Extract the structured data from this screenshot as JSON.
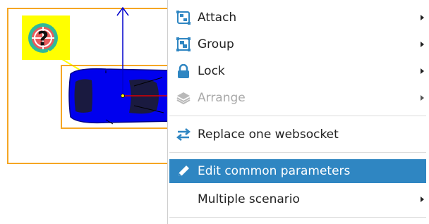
{
  "menu": {
    "items": [
      {
        "label": "Attach",
        "icon": "attach-icon",
        "submenu": true,
        "disabled": false,
        "highlighted": false
      },
      {
        "label": "Group",
        "icon": "group-icon",
        "submenu": true,
        "disabled": false,
        "highlighted": false
      },
      {
        "label": "Lock",
        "icon": "lock-icon",
        "submenu": true,
        "disabled": false,
        "highlighted": false
      },
      {
        "label": "Arrange",
        "icon": "layers-icon",
        "submenu": true,
        "disabled": true,
        "highlighted": false
      },
      {
        "label": "Replace one websocket",
        "icon": "swap-arrows-icon",
        "submenu": false,
        "disabled": false,
        "highlighted": false
      },
      {
        "label": "Edit common parameters",
        "icon": "pencil-icon",
        "submenu": false,
        "disabled": false,
        "highlighted": true
      },
      {
        "label": "Multiple scenario",
        "icon": "",
        "submenu": true,
        "disabled": false,
        "highlighted": false
      }
    ]
  },
  "canvas": {
    "selection_color": "#f5a623",
    "car_color": "#0000ee",
    "badge_background": "#ffff00",
    "badge_icon": "radar-question-icon"
  },
  "colors": {
    "menu_icon": "#2f86c2",
    "highlight": "#2f86c2"
  }
}
